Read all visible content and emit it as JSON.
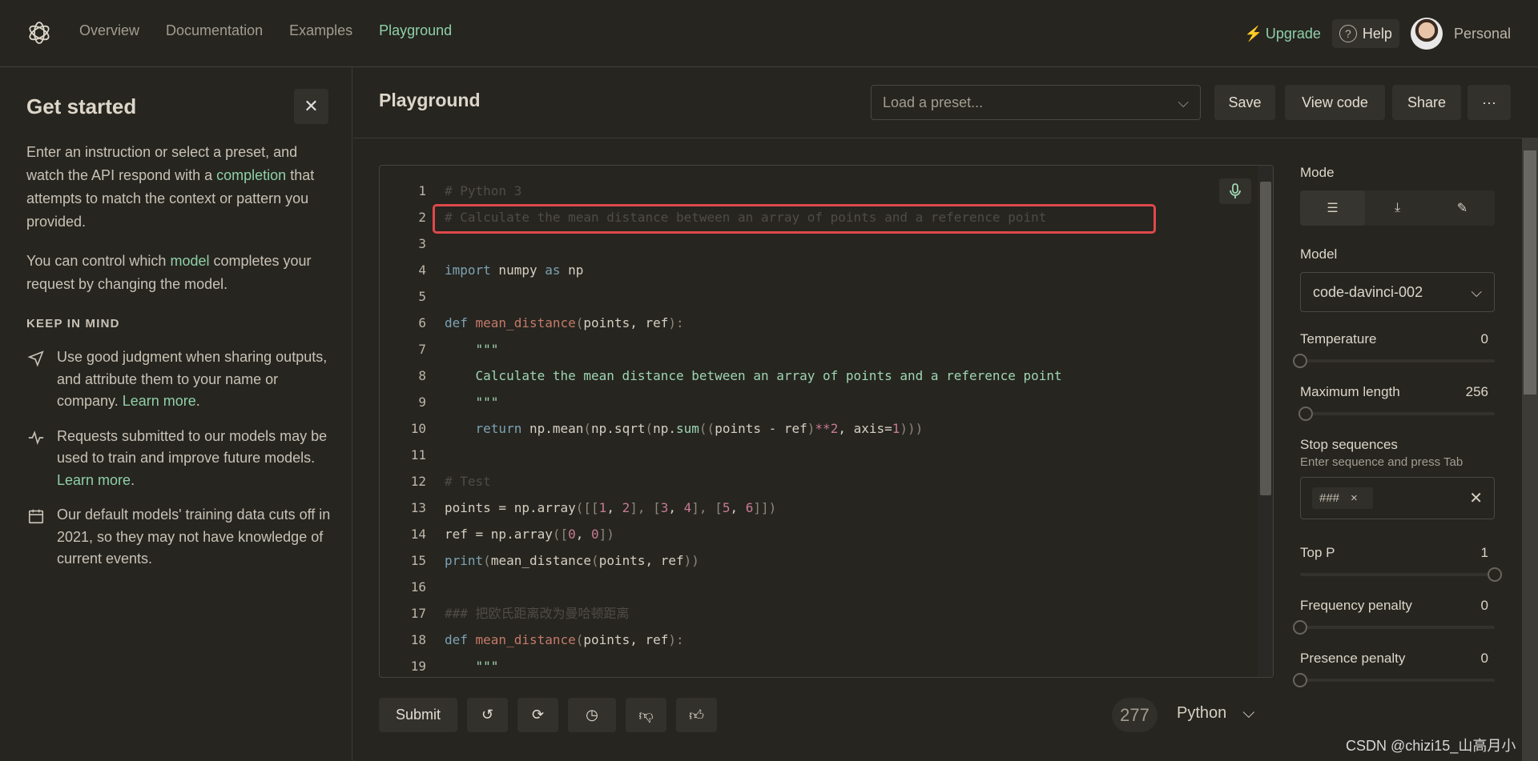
{
  "header": {
    "nav": [
      "Overview",
      "Documentation",
      "Examples",
      "Playground"
    ],
    "active": "Playground",
    "upgrade": "Upgrade",
    "help": "Help",
    "account": "Personal"
  },
  "sidebar": {
    "title": "Get started",
    "p1": [
      "Enter an instruction or select a preset, and watch the API respond with a ",
      "completion",
      " that attempts to match the context or pattern you provided."
    ],
    "p2": [
      "You can control which ",
      "model",
      " completes your request by changing the model."
    ],
    "keep_in_mind": "KEEP IN MIND",
    "tips": [
      {
        "icon": "send-icon",
        "text": "Use good judgment when sharing outputs, and attribute them to your name or company. ",
        "link": "Learn more",
        "end": "."
      },
      {
        "icon": "activity-icon",
        "text": "Requests submitted to our models may be used to train and improve future models. ",
        "link": "Learn more",
        "end": "."
      },
      {
        "icon": "calendar-icon",
        "text": "Our default models' training data cuts off in 2021, so they may not have knowledge of current events.",
        "link": "",
        "end": ""
      }
    ]
  },
  "toolbar": {
    "title": "Playground",
    "preset_placeholder": "Load a preset...",
    "save": "Save",
    "view_code": "View code",
    "share": "Share",
    "more": "···"
  },
  "editor": {
    "lines": [
      [
        [
          "# Python 3",
          "cm"
        ]
      ],
      [
        [
          "# Calculate the mean distance between an array of points and a reference point",
          "cm"
        ]
      ],
      [],
      [
        [
          "import",
          "kw"
        ],
        [
          " numpy ",
          "pl"
        ],
        [
          "as",
          "kw"
        ],
        [
          " np",
          "pl"
        ]
      ],
      [],
      [
        [
          "def ",
          "kw"
        ],
        [
          "mean_distance",
          "fn"
        ],
        [
          "(",
          "pu"
        ],
        [
          "points, ref",
          "pl"
        ],
        [
          "):",
          "pu"
        ]
      ],
      [
        [
          "    \"\"\"",
          "st"
        ]
      ],
      [
        [
          "    Calculate the mean distance between an array of points and a reference point",
          "st"
        ]
      ],
      [
        [
          "    \"\"\"",
          "st"
        ]
      ],
      [
        [
          "    ",
          "pl"
        ],
        [
          "return",
          "kw"
        ],
        [
          " np.mean",
          "pl"
        ],
        [
          "(",
          "pu"
        ],
        [
          "np.sqrt",
          "pl"
        ],
        [
          "(",
          "pu"
        ],
        [
          "np.",
          "pl"
        ],
        [
          "sum",
          "st"
        ],
        [
          "((",
          "pu"
        ],
        [
          "points - ref",
          "pl"
        ],
        [
          ")",
          "pu"
        ],
        [
          "**",
          "nu"
        ],
        [
          "2",
          "nu"
        ],
        [
          ", axis=",
          "pl"
        ],
        [
          "1",
          "nu"
        ],
        [
          ")))",
          "pu"
        ]
      ],
      [],
      [
        [
          "# Test",
          "cm"
        ]
      ],
      [
        [
          "points = np.array",
          "pl"
        ],
        [
          "([[",
          "pu"
        ],
        [
          "1",
          "nu"
        ],
        [
          ", ",
          "pl"
        ],
        [
          "2",
          "nu"
        ],
        [
          "], [",
          "pu"
        ],
        [
          "3",
          "nu"
        ],
        [
          ", ",
          "pl"
        ],
        [
          "4",
          "nu"
        ],
        [
          "], [",
          "pu"
        ],
        [
          "5",
          "nu"
        ],
        [
          ", ",
          "pl"
        ],
        [
          "6",
          "nu"
        ],
        [
          "]])",
          "pu"
        ]
      ],
      [
        [
          "ref = np.array",
          "pl"
        ],
        [
          "([",
          "pu"
        ],
        [
          "0",
          "nu"
        ],
        [
          ", ",
          "pl"
        ],
        [
          "0",
          "nu"
        ],
        [
          "])",
          "pu"
        ]
      ],
      [
        [
          "print",
          "bl"
        ],
        [
          "(",
          "pu"
        ],
        [
          "mean_distance",
          "pl"
        ],
        [
          "(",
          "pu"
        ],
        [
          "points, ref",
          "pl"
        ],
        [
          "))",
          "pu"
        ]
      ],
      [],
      [
        [
          "### 把欧氏距离改为曼哈顿距离",
          "cm"
        ]
      ],
      [
        [
          "def ",
          "kw"
        ],
        [
          "mean_distance",
          "fn"
        ],
        [
          "(",
          "pu"
        ],
        [
          "points, ref",
          "pl"
        ],
        [
          "):",
          "pu"
        ]
      ],
      [
        [
          "    \"\"\"",
          "st"
        ]
      ]
    ],
    "highlight_color": "#e0484a"
  },
  "bottom": {
    "submit": "Submit",
    "token_count": "277",
    "language": "Python"
  },
  "panel": {
    "mode_label": "Mode",
    "model_label": "Model",
    "model": "code-davinci-002",
    "temperature": {
      "label": "Temperature",
      "value": "0",
      "fraction": 0
    },
    "max_length": {
      "label": "Maximum length",
      "value": "256",
      "fraction": 0.03
    },
    "stop": {
      "label": "Stop sequences",
      "hint": "Enter sequence and press Tab",
      "chip": "###"
    },
    "top_p": {
      "label": "Top P",
      "value": "1",
      "fraction": 1
    },
    "freq": {
      "label": "Frequency penalty",
      "value": "0",
      "fraction": 0
    },
    "pres": {
      "label": "Presence penalty",
      "value": "0",
      "fraction": 0
    }
  },
  "watermark": "CSDN @chizi15_山高月小",
  "colors": {
    "accent": "#8fd0a8",
    "background": "#262520"
  }
}
